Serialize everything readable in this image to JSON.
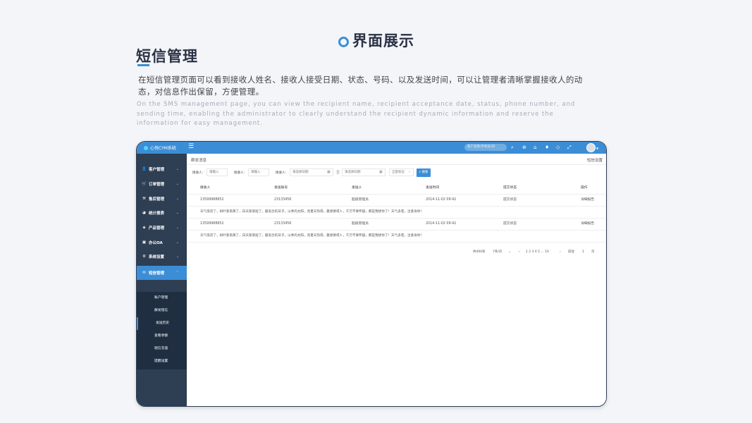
{
  "slide": {
    "header": "界面展示",
    "section_title": "短信管理",
    "desc_cn": "在短信管理页面可以看到接收人姓名、接收人接受日期、状态、号码、以及发送时间，可以让管理者清晰掌握接收人的动态，对信息作出保留，方便管理。",
    "desc_en": "On the SMS management page, you can view the recipient name, recipient acceptance date, status, phone number, and sending time, enabling the administrator to clearly understand the recipient dynamic information and reserve the information for easy management.",
    "accent_color": "#3a8fd6"
  },
  "app": {
    "brand": "心悦CYM系统",
    "menu_toggle": "☰",
    "search_placeholder": "客户名称/手机号/ID",
    "icons": [
      "search-icon",
      "settings-icon",
      "home-icon",
      "notification-icon",
      "tag-icon",
      "fullscreen-icon"
    ],
    "colors": {
      "topbar": "#3b8ed6",
      "sidebar": "#2e3e53",
      "submenu": "#1f2e41"
    },
    "sidebar": {
      "items": [
        {
          "label": "客户管理",
          "icon": "user-icon",
          "glyph": "👤"
        },
        {
          "label": "订单管理",
          "icon": "cart-icon",
          "glyph": "🛒"
        },
        {
          "label": "售后管理",
          "icon": "service-icon",
          "glyph": "⚒"
        },
        {
          "label": "统计报表",
          "icon": "chart-icon",
          "glyph": "◕"
        },
        {
          "label": "产品管理",
          "icon": "product-icon",
          "glyph": "◈"
        },
        {
          "label": "办公OA",
          "icon": "office-icon",
          "glyph": "▣"
        },
        {
          "label": "系统设置",
          "icon": "gear-icon",
          "glyph": "⚙"
        },
        {
          "label": "短信管理",
          "icon": "sms-icon",
          "glyph": "✉"
        }
      ],
      "submenu": [
        "账户管理",
        "群发短信",
        "发送历史",
        "查看余额",
        "短信充值",
        "提醒设置"
      ]
    },
    "breadcrumb": "群发消息",
    "breadcrumb_right": "短信设置",
    "filters": {
      "receiver_label1": "接收人:",
      "receiver_placeholder1": "请输入",
      "receiver_label2": "接收人:",
      "receiver_placeholder2": "请输入",
      "receiver_label3": "接收人:",
      "date_start": "请选择日期",
      "date_sep": "至",
      "date_end": "请选择日期",
      "status_select": "全部状态",
      "search_button": "搜索"
    },
    "table": {
      "headers": [
        "接收人",
        "发送账号",
        "发送人",
        "发送时间",
        "提交状态",
        "操作"
      ],
      "rows": [
        {
          "cells": [
            "13599988852",
            "23133456",
            "超级管理员",
            "2014-11-02  09:42",
            "提交状态",
            "详细报告"
          ],
          "message": "天气渐凉了，树叶渐渐黄了，白天渐渐短了，最思念的日子，以季的太阳，亮夏天热得，最想要得人，千万不要怀疑，那是我想你了！天气多变，注意身体！"
        },
        {
          "cells": [
            "13599988852",
            "23133456",
            "超级管理员",
            "2014-11-02  09:42",
            "提交状态",
            "详细报告"
          ],
          "message": "天气渐凉了，树叶渐渐黄了，白天渐渐短了，最思念的日子，以季的太阳，亮夏天热得，最想要得人，千万不要怀疑，那是我想你了！天气多变，注意身体！"
        }
      ]
    },
    "pager": {
      "total": "共400条",
      "page_size": "7条/页",
      "prev": "‹",
      "pages": "1  2  3  4  5  ...  10",
      "next": "›",
      "goto_label": "前往",
      "goto_value": "1",
      "page_unit": "页"
    }
  }
}
